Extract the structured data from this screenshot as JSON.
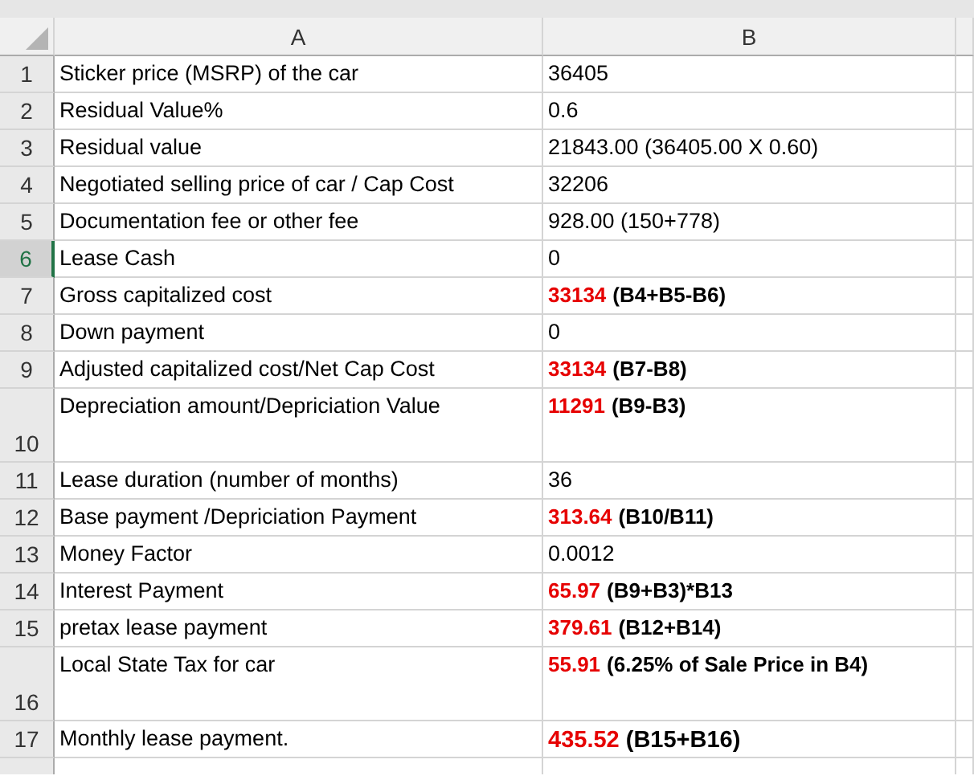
{
  "columns": [
    "A",
    "B"
  ],
  "rows": [
    {
      "number": "1",
      "label": "Sticker price (MSRP) of the car",
      "kind": "plain",
      "value": "36405",
      "selected": false,
      "tall": false
    },
    {
      "number": "2",
      "label": "Residual Value%",
      "kind": "plain",
      "value": "0.6",
      "selected": false,
      "tall": false
    },
    {
      "number": "3",
      "label": "Residual value",
      "kind": "plain",
      "value": "21843.00 (36405.00 X 0.60)",
      "selected": false,
      "tall": false
    },
    {
      "number": "4",
      "label": "Negotiated selling price of car / Cap Cost",
      "kind": "plain",
      "value": "32206",
      "selected": false,
      "tall": false
    },
    {
      "number": "5",
      "label": "Documentation fee or other fee",
      "kind": "plain",
      "value": "928.00 (150+778)",
      "selected": false,
      "tall": false
    },
    {
      "number": "6",
      "label": "Lease Cash",
      "kind": "plain",
      "value": "0",
      "selected": true,
      "tall": false
    },
    {
      "number": "7",
      "label": "Gross capitalized cost",
      "kind": "formula",
      "value": "33134",
      "note": "(B4+B5-B6)",
      "selected": false,
      "tall": false
    },
    {
      "number": "8",
      "label": "Down payment",
      "kind": "plain",
      "value": "0",
      "selected": false,
      "tall": false
    },
    {
      "number": "9",
      "label": "Adjusted capitalized cost/Net Cap Cost",
      "kind": "formula",
      "value": "33134",
      "note": "(B7-B8)",
      "selected": false,
      "tall": false
    },
    {
      "number": "10",
      "label": "Depreciation amount/Depriciation Value",
      "kind": "formula",
      "value": "11291",
      "note": "(B9-B3)",
      "selected": false,
      "tall": true
    },
    {
      "number": "11",
      "label": "Lease duration (number of months)",
      "kind": "plain",
      "value": "36",
      "selected": false,
      "tall": false
    },
    {
      "number": "12",
      "label": "Base payment /Depriciation Payment",
      "kind": "formula",
      "value": "313.64",
      "note": "(B10/B11)",
      "selected": false,
      "tall": false
    },
    {
      "number": "13",
      "label": "Money Factor",
      "kind": "plain",
      "value": "0.0012",
      "selected": false,
      "tall": false
    },
    {
      "number": "14",
      "label": "Interest Payment",
      "kind": "formula",
      "value": "65.97",
      "note": "(B9+B3)*B13",
      "selected": false,
      "tall": false
    },
    {
      "number": "15",
      "label": "pretax lease payment",
      "kind": "formula",
      "value": "379.61",
      "note": "(B12+B14)",
      "selected": false,
      "tall": false
    },
    {
      "number": "16",
      "label": "Local State Tax for car",
      "kind": "formula",
      "value": "55.91",
      "note": "(6.25% of Sale Price in B4)",
      "selected": false,
      "tall": true
    },
    {
      "number": "17",
      "label": "Monthly lease payment.",
      "kind": "total",
      "value": "435.52",
      "note": "(B15+B16)",
      "selected": false,
      "tall": false
    }
  ]
}
